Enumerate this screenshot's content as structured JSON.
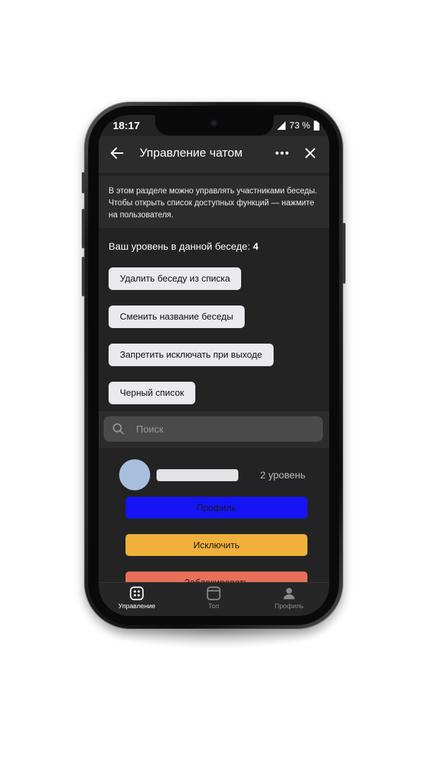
{
  "status": {
    "time": "18:17",
    "battery": "73 %"
  },
  "header": {
    "title": "Управление чатом"
  },
  "info": {
    "text": "В этом разделе можно управлять участниками беседы. Чтобы открыть список доступных функций — нажмите на пользователя."
  },
  "level": {
    "label": "Ваш уровень в данной беседе:",
    "value": "4"
  },
  "actions": [
    {
      "label": "Удалить беседу из списка"
    },
    {
      "label": "Сменить название беседы"
    },
    {
      "label": "Запретить исключать при выходе"
    },
    {
      "label": "Черный список"
    }
  ],
  "search": {
    "placeholder": "Поиск"
  },
  "member": {
    "level": "2 уровень",
    "buttons": [
      {
        "label": "Профиль",
        "color": "#1414f5"
      },
      {
        "label": "Исключить",
        "color": "#f0b03a"
      },
      {
        "label": "Заблокировать",
        "color": "#e8705a"
      }
    ]
  },
  "tabs": [
    {
      "label": "Управление",
      "icon": "grid-icon",
      "active": true
    },
    {
      "label": "Топ",
      "icon": "window-icon",
      "active": false
    },
    {
      "label": "Профиль",
      "icon": "person-icon",
      "active": false
    }
  ],
  "colors": {
    "background": "#232323",
    "panel": "#2c2c2c",
    "accent_blue": "#1414f5",
    "accent_yellow": "#f0b03a",
    "accent_red": "#e8705a"
  }
}
